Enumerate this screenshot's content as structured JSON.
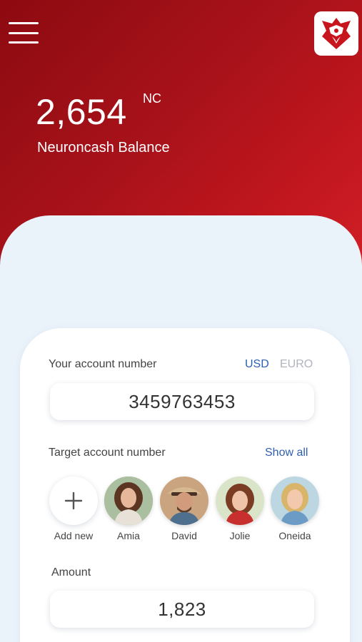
{
  "header": {
    "balance_value": "2,654",
    "balance_unit": "NC",
    "balance_label": "Neuroncash Balance",
    "menu_icon": "hamburger-menu-icon",
    "logo_icon": "brand-logo-icon"
  },
  "account": {
    "label": "Your account number",
    "currency_options": [
      "USD",
      "EURO"
    ],
    "currency_selected": "USD",
    "usd_label": "USD",
    "euro_label": "EURO",
    "number": "3459763453"
  },
  "target": {
    "label": "Target account number",
    "show_all": "Show all",
    "add_new": "Add new",
    "contacts": [
      {
        "name": "Amia"
      },
      {
        "name": "David"
      },
      {
        "name": "Jolie"
      },
      {
        "name": "Oneida"
      }
    ]
  },
  "amount": {
    "label": "Amount",
    "value": "1,823"
  },
  "colors": {
    "brand_red": "#b5141b",
    "link_blue": "#2f5fb0",
    "muted": "#b0b4bb",
    "background": "#eaf2fa"
  }
}
